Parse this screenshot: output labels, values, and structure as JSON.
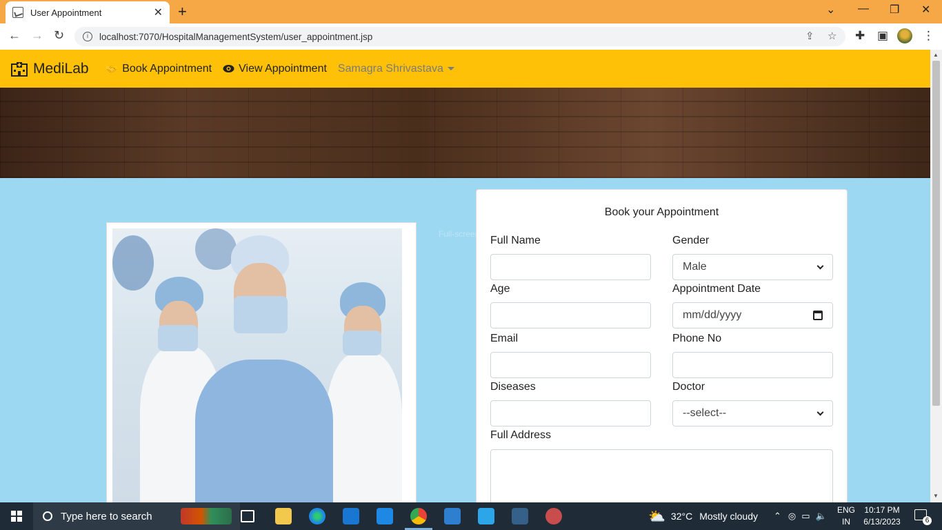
{
  "browser": {
    "tab_title": "User Appointment",
    "url": "localhost:7070/HospitalManagementSystem/user_appointment.jsp"
  },
  "navbar": {
    "brand": "MediLab",
    "links": [
      {
        "label": "Book Appointment",
        "icon": "handshake-icon"
      },
      {
        "label": "View Appointment",
        "icon": "eye-icon"
      }
    ],
    "user": "Samagra Shrivastava"
  },
  "watermark": "Full-screen",
  "form": {
    "title": "Book your Appointment",
    "full_name_label": "Full Name",
    "gender_label": "Gender",
    "gender_value": "Male",
    "age_label": "Age",
    "date_label": "Appointment Date",
    "date_placeholder": "mm/dd/yyyy",
    "email_label": "Email",
    "phone_label": "Phone No",
    "diseases_label": "Diseases",
    "doctor_label": "Doctor",
    "doctor_value": "--select--",
    "address_label": "Full Address"
  },
  "taskbar": {
    "search_placeholder": "Type here to search",
    "weather_temp": "32°C",
    "weather_desc": "Mostly cloudy",
    "lang_top": "ENG",
    "lang_bottom": "IN",
    "time": "10:17 PM",
    "date": "6/13/2023",
    "notif_count": "6"
  }
}
